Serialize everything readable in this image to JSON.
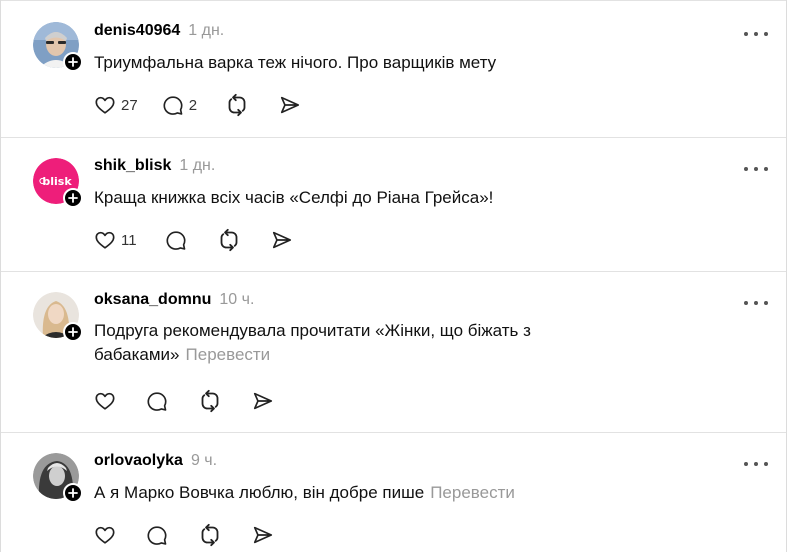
{
  "posts": [
    {
      "username": "denis40964",
      "time": "1 дн.",
      "text": "Триумфальна варка теж нічого. Про варщиків мету",
      "translate": "",
      "likes": "27",
      "replies": "2",
      "avatar_color": "#6f8fb5"
    },
    {
      "username": "shik_blisk",
      "time": "1 дн.",
      "text": "Краща книжка всіх часів «Селфі до Ріана Грейса»!",
      "translate": "",
      "likes": "11",
      "replies": "",
      "avatar_color": "#ee1e7a",
      "avatar_logo": "blisk"
    },
    {
      "username": "oksana_domnu",
      "time": "10 ч.",
      "text": "Подруга рекомендувала прочитати «Жінки, що біжать з бабаками»",
      "translate": "Перевести",
      "likes": "",
      "replies": "",
      "avatar_color": "#d8c3ad"
    },
    {
      "username": "orlovaolyka",
      "time": "9 ч.",
      "text": "А я Марко Вовчка люблю, він добре пише",
      "translate": "Перевести",
      "likes": "",
      "replies": "",
      "avatar_color": "#4a4a4a"
    }
  ],
  "icons": {
    "like": "heart-icon",
    "reply": "comment-icon",
    "repost": "repost-icon",
    "share": "send-icon",
    "more": "more-icon",
    "follow": "plus-icon"
  },
  "colors": {
    "text": "#111111",
    "muted": "#999999",
    "divider": "#e2e2e2",
    "blisk_pink": "#ee1e7a"
  }
}
